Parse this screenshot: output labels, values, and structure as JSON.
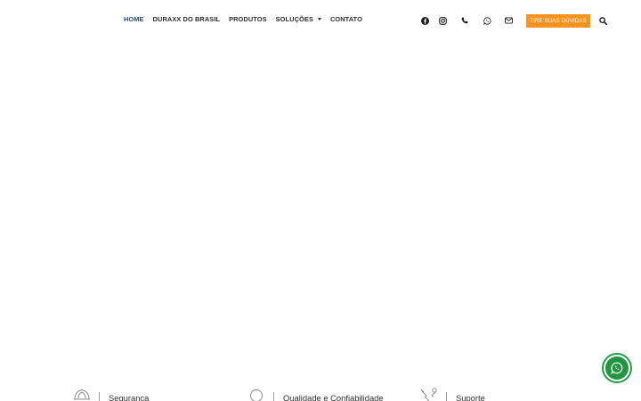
{
  "nav": {
    "items": [
      {
        "label": "HOME",
        "active": true
      },
      {
        "label": "DURAXX DO BRASIL",
        "active": false
      },
      {
        "label": "PRODUTOS",
        "active": false
      },
      {
        "label": "SOLUÇÕES",
        "active": false,
        "has_dropdown": true
      },
      {
        "label": "CONTATO",
        "active": false
      }
    ]
  },
  "social_icons": [
    "facebook-icon",
    "instagram-icon",
    "phone-icon",
    "whatsapp-icon",
    "email-icon"
  ],
  "cta": {
    "label": "TIRE SUAS DÚVIDAS"
  },
  "search_icon": "search-icon",
  "features": [
    {
      "label": "Segurança",
      "icon": "helmet-icon"
    },
    {
      "label": "Qualidade e Confiabilidade",
      "icon": "badge-icon"
    },
    {
      "label": "Suporte",
      "icon": "tools-icon"
    }
  ],
  "colors": {
    "nav_active": "#1a4f8b",
    "nav_text": "#2d2d2d",
    "cta_bg": "#f7931e",
    "whatsapp_green": "#22963f"
  }
}
